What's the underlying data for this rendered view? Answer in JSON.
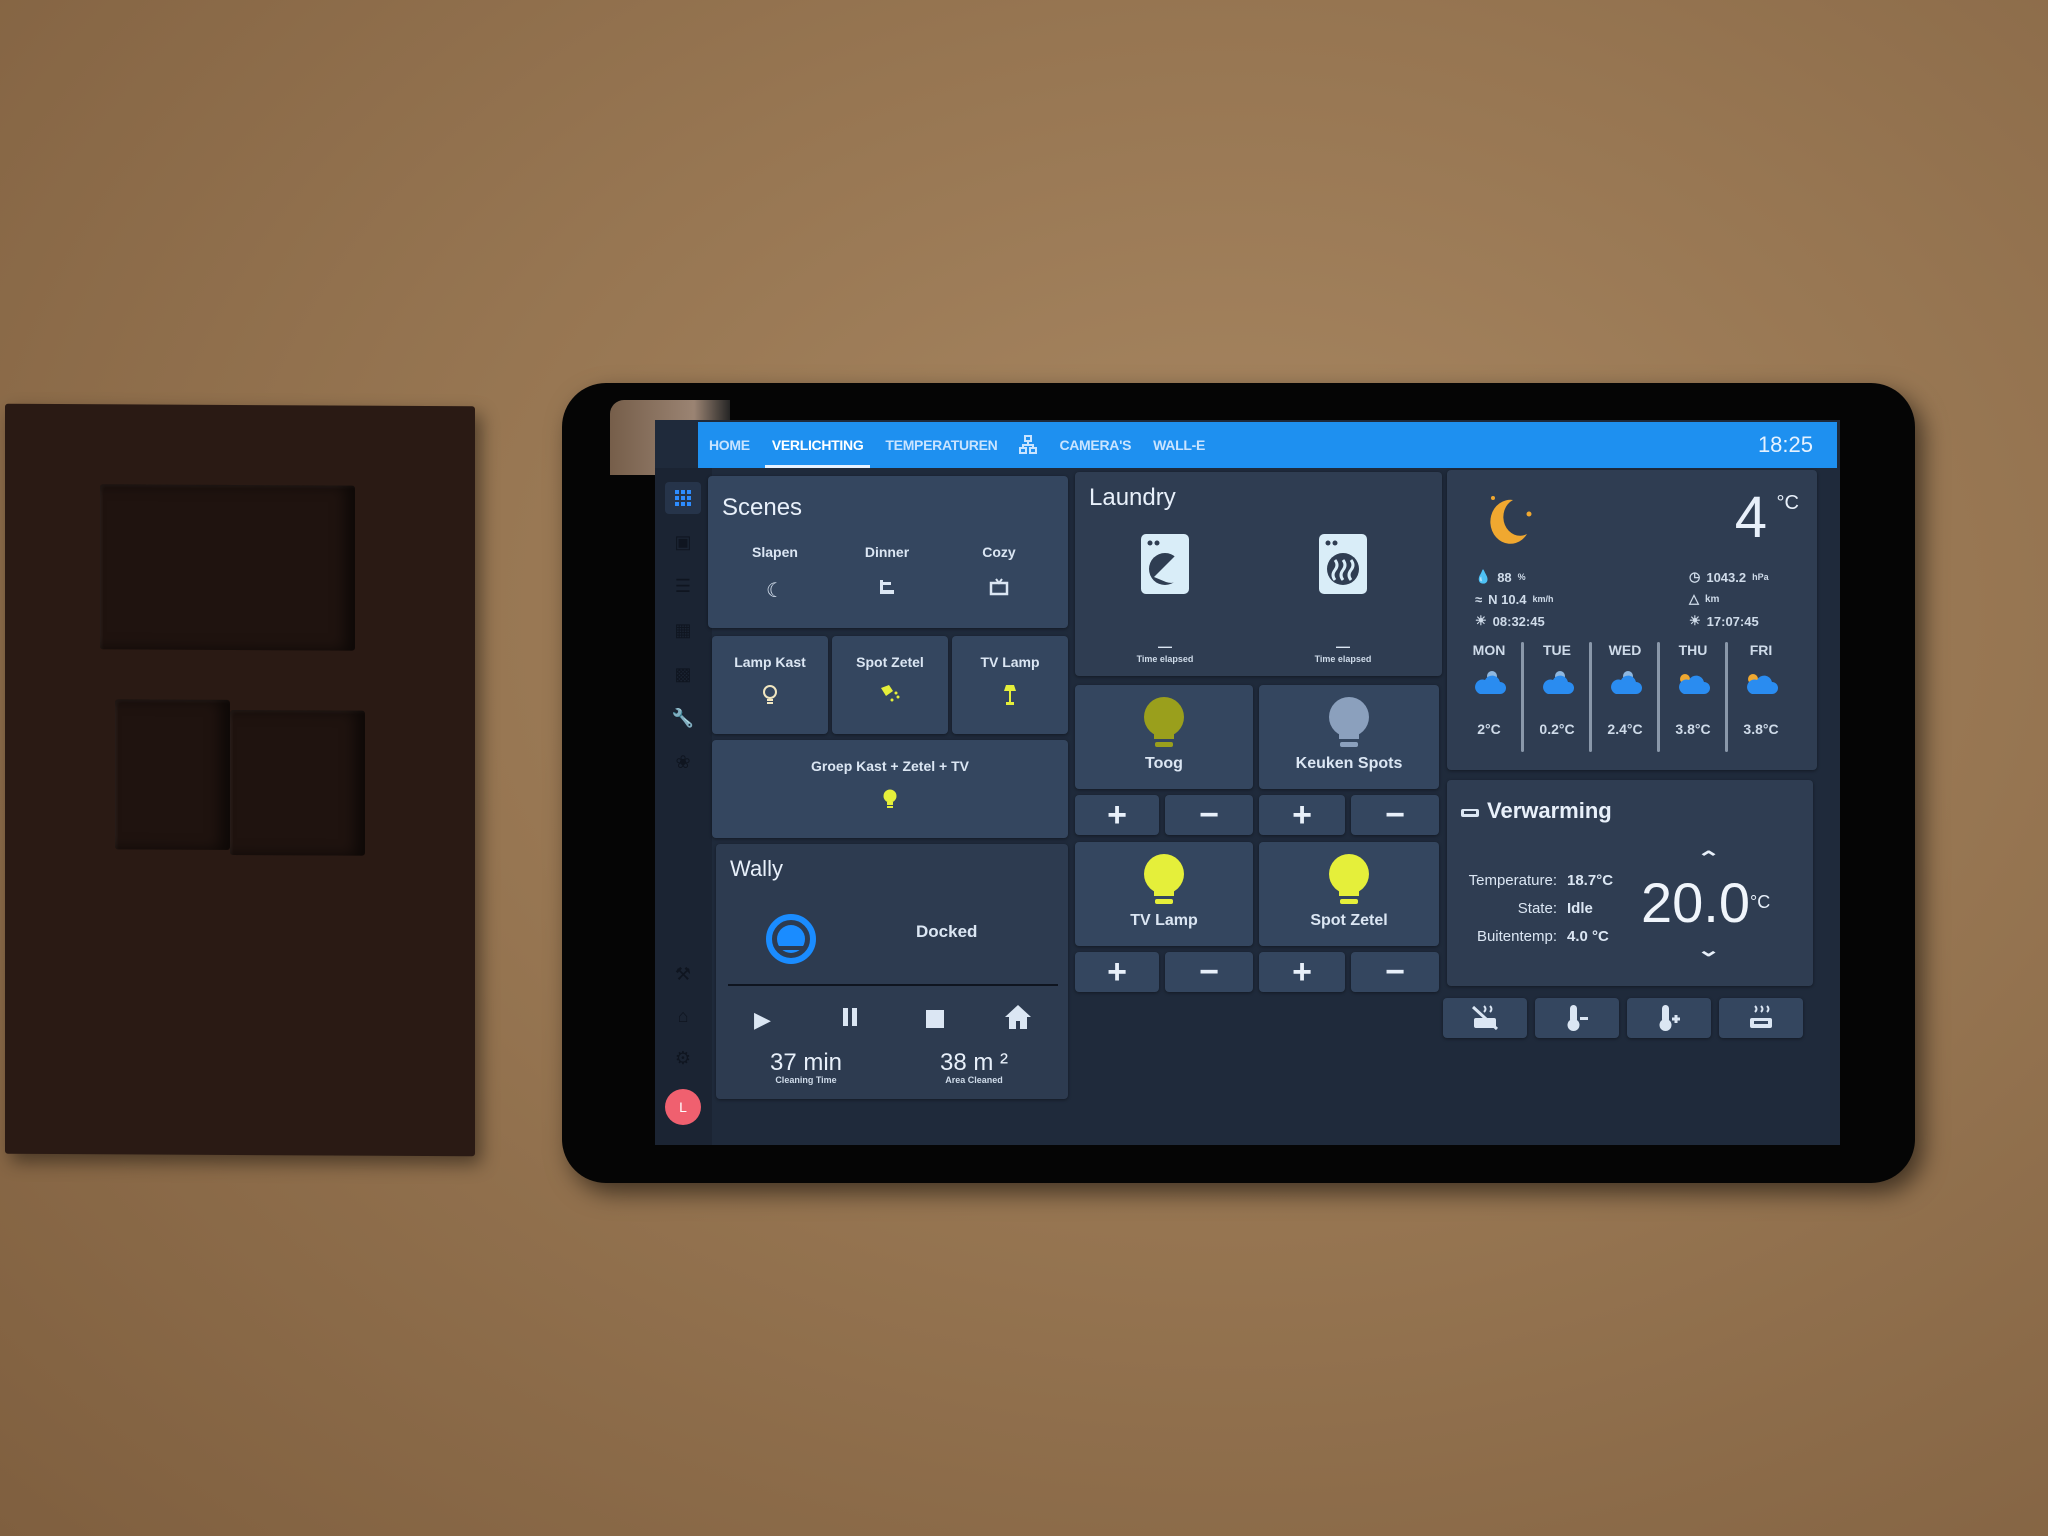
{
  "header": {
    "tabs": [
      {
        "label": "HOME",
        "active": false
      },
      {
        "label": "VERLICHTING",
        "active": true
      },
      {
        "label": "TEMPERATUREN",
        "active": false
      },
      {
        "label": "network-icon",
        "active": false
      },
      {
        "label": "CAMERA'S",
        "active": false
      },
      {
        "label": "WALL-E",
        "active": false
      }
    ],
    "clock": "18:25",
    "accent": "#1e90f0"
  },
  "sidebar": {
    "items": [
      "grid-icon",
      "account-box-icon",
      "list-icon",
      "chart-box-icon",
      "alpha-box-icon",
      "wrench-icon",
      "bug-icon",
      "hammer-icon",
      "home-icon",
      "settings-icon",
      "bell-icon"
    ],
    "avatar_initial": "L",
    "avatar_color": "#f0606f"
  },
  "scenes": {
    "title": "Scenes",
    "items": [
      {
        "label": "Slapen",
        "icon": "moon-icon"
      },
      {
        "label": "Dinner",
        "icon": "dinner-icon"
      },
      {
        "label": "Cozy",
        "icon": "tv-icon"
      }
    ]
  },
  "small_lights": [
    {
      "label": "Lamp Kast",
      "icon": "bulb-outline-icon",
      "on": false
    },
    {
      "label": "Spot Zetel",
      "icon": "spotlight-icon",
      "on": true
    },
    {
      "label": "TV Lamp",
      "icon": "floor-lamp-icon",
      "on": true
    }
  ],
  "group": {
    "label": "Groep Kast + Zetel + TV",
    "on": true
  },
  "vacuum": {
    "title": "Wally",
    "status": "Docked",
    "controls": [
      "play",
      "pause",
      "stop",
      "home"
    ],
    "cleaning_time": "37 min",
    "cleaning_time_label": "Cleaning Time",
    "area": "38 m ²",
    "area_label": "Area Cleaned"
  },
  "laundry": {
    "title": "Laundry",
    "machines": [
      {
        "icon": "washing-machine-icon",
        "value": "—",
        "label": "Time elapsed"
      },
      {
        "icon": "tumble-dryer-icon",
        "value": "—",
        "label": "Time elapsed"
      }
    ]
  },
  "lights": [
    {
      "label": "Toog",
      "color": "#9a9f1c"
    },
    {
      "label": "Keuken Spots",
      "color": "#8ba0bd"
    },
    {
      "label": "TV Lamp",
      "color": "#e5ef3a"
    },
    {
      "label": "Spot Zetel",
      "color": "#e5ef3a"
    }
  ],
  "dim_buttons": {
    "plus": "+",
    "minus": "−"
  },
  "weather": {
    "temp": "4",
    "unit": "°C",
    "humidity": "88",
    "humidity_unit": "%",
    "wind": "N 10.4",
    "wind_unit": "km/h",
    "sunrise": "08:32:45",
    "pressure": "1043.2",
    "pressure_unit": "hPa",
    "visibility_unit": "km",
    "sunset": "17:07:45",
    "forecast": [
      {
        "day": "MON",
        "temp": "2°C",
        "icon": "cloudy"
      },
      {
        "day": "TUE",
        "temp": "0.2°C",
        "icon": "cloudy"
      },
      {
        "day": "WED",
        "temp": "2.4°C",
        "icon": "cloudy"
      },
      {
        "day": "THU",
        "temp": "3.8°C",
        "icon": "partly-cloudy"
      },
      {
        "day": "FRI",
        "temp": "3.8°C",
        "icon": "partly-cloudy"
      }
    ]
  },
  "thermostat": {
    "title": "Verwarming",
    "temperature_label": "Temperature:",
    "temperature": "18.7°C",
    "state_label": "State:",
    "state": "Idle",
    "outside_label": "Buitentemp:",
    "outside": "4.0 °C",
    "target": "20.0",
    "target_unit": "°C",
    "buttons": [
      "heating-off-icon",
      "temp-down-icon",
      "temp-up-icon",
      "heating-on-icon"
    ]
  }
}
